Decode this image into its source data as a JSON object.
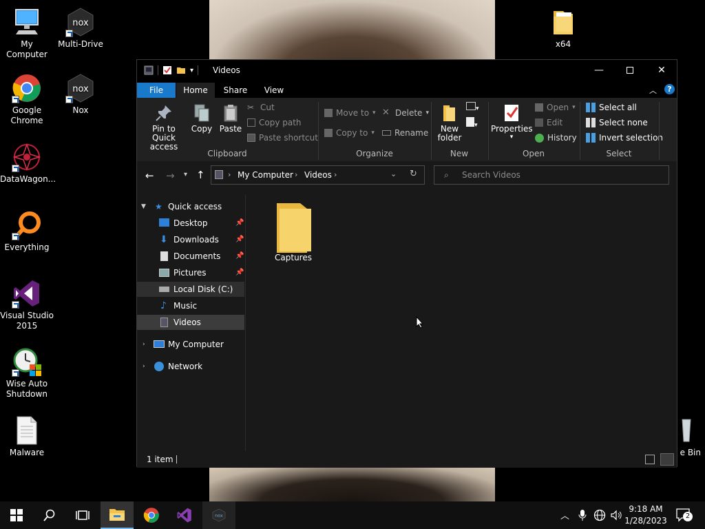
{
  "desktop": {
    "icons": [
      {
        "label": "My Computer"
      },
      {
        "label": "Multi-Drive"
      },
      {
        "label": "x64"
      },
      {
        "label": "Google Chrome"
      },
      {
        "label": "Nox"
      },
      {
        "label": "DataWagon..."
      },
      {
        "label": "Everything"
      },
      {
        "label": "Visual Studio 2015"
      },
      {
        "label": "Wise Auto Shutdown"
      },
      {
        "label": "Malware"
      },
      {
        "label": "e Bin"
      }
    ]
  },
  "window": {
    "title": "Videos",
    "tabs": {
      "file": "File",
      "home": "Home",
      "share": "Share",
      "view": "View"
    },
    "ribbon": {
      "clipboard": {
        "group_label": "Clipboard",
        "pin_line1": "Pin to Quick",
        "pin_line2": "access",
        "copy": "Copy",
        "paste": "Paste",
        "cut": "Cut",
        "copy_path": "Copy path",
        "paste_shortcut": "Paste shortcut"
      },
      "organize": {
        "group_label": "Organize",
        "move_to": "Move to",
        "copy_to": "Copy to",
        "delete": "Delete",
        "rename": "Rename"
      },
      "new": {
        "group_label": "New",
        "new_line1": "New",
        "new_line2": "folder"
      },
      "open": {
        "group_label": "Open",
        "properties": "Properties",
        "open": "Open",
        "edit": "Edit",
        "history": "History"
      },
      "select": {
        "group_label": "Select",
        "select_all": "Select all",
        "select_none": "Select none",
        "invert": "Invert selection"
      }
    },
    "address": {
      "crumbs": [
        "My Computer",
        "Videos"
      ],
      "search_placeholder": "Search Videos"
    },
    "nav": {
      "quick_access": "Quick access",
      "items": [
        {
          "label": "Desktop"
        },
        {
          "label": "Downloads"
        },
        {
          "label": "Documents"
        },
        {
          "label": "Pictures"
        },
        {
          "label": "Local Disk (C:)"
        },
        {
          "label": "Music"
        },
        {
          "label": "Videos"
        }
      ],
      "my_computer": "My Computer",
      "network": "Network"
    },
    "content": {
      "folders": [
        {
          "label": "Captures"
        }
      ]
    },
    "status": {
      "count": "1 item"
    }
  },
  "taskbar": {
    "time": "9:18 AM",
    "date": "1/28/2023",
    "notification_count": "2"
  },
  "colors": {
    "accent": "#1979ca",
    "folder": "#f3c34a",
    "window_bg": "#191919",
    "ribbon_bg": "#212121"
  }
}
